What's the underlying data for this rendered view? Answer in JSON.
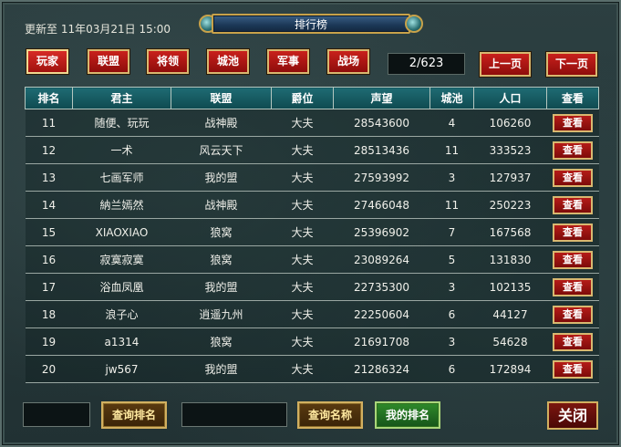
{
  "header": {
    "update_text": "更新至 11年03月21日 15:00",
    "title": "排行榜"
  },
  "categories": [
    {
      "label": "玩家",
      "active": true
    },
    {
      "label": "联盟"
    },
    {
      "label": "将领"
    },
    {
      "label": "城池"
    },
    {
      "label": "军事"
    },
    {
      "label": "战场"
    }
  ],
  "pagination": {
    "page_text": "2/623",
    "prev_label": "上一页",
    "next_label": "下一页"
  },
  "table": {
    "headers": [
      "排名",
      "君主",
      "联盟",
      "爵位",
      "声望",
      "城池",
      "人口",
      "查看"
    ],
    "view_label": "查看",
    "rows": [
      {
        "rank": "11",
        "lord": "随便、玩玩",
        "alliance": "战神殿",
        "title": "大夫",
        "prestige": "28543600",
        "cities": "4",
        "population": "106260"
      },
      {
        "rank": "12",
        "lord": "一术",
        "alliance": "风云天下",
        "title": "大夫",
        "prestige": "28513436",
        "cities": "11",
        "population": "333523"
      },
      {
        "rank": "13",
        "lord": "七画军师",
        "alliance": "我的盟",
        "title": "大夫",
        "prestige": "27593992",
        "cities": "3",
        "population": "127937"
      },
      {
        "rank": "14",
        "lord": "納兰嫣然",
        "alliance": "战神殿",
        "title": "大夫",
        "prestige": "27466048",
        "cities": "11",
        "population": "250223"
      },
      {
        "rank": "15",
        "lord": "XIAOXIAO",
        "alliance": "狼窝",
        "title": "大夫",
        "prestige": "25396902",
        "cities": "7",
        "population": "167568"
      },
      {
        "rank": "16",
        "lord": "寂寞寂寞",
        "alliance": "狼窝",
        "title": "大夫",
        "prestige": "23089264",
        "cities": "5",
        "population": "131830"
      },
      {
        "rank": "17",
        "lord": "浴血凤凰",
        "alliance": "我的盟",
        "title": "大夫",
        "prestige": "22735300",
        "cities": "3",
        "population": "102135"
      },
      {
        "rank": "18",
        "lord": "浪子心",
        "alliance": "逍遥九州",
        "title": "大夫",
        "prestige": "22250604",
        "cities": "6",
        "population": "44127"
      },
      {
        "rank": "19",
        "lord": "a1314",
        "alliance": "狼窝",
        "title": "大夫",
        "prestige": "21691708",
        "cities": "3",
        "population": "54628"
      },
      {
        "rank": "20",
        "lord": "jw567",
        "alliance": "我的盟",
        "title": "大夫",
        "prestige": "21286324",
        "cities": "6",
        "population": "172894"
      }
    ]
  },
  "footer": {
    "rank_input_value": "",
    "query_rank_label": "查询排名",
    "name_input_value": "",
    "query_name_label": "查询名称",
    "my_rank_label": "我的排名",
    "close_label": "关闭"
  }
}
